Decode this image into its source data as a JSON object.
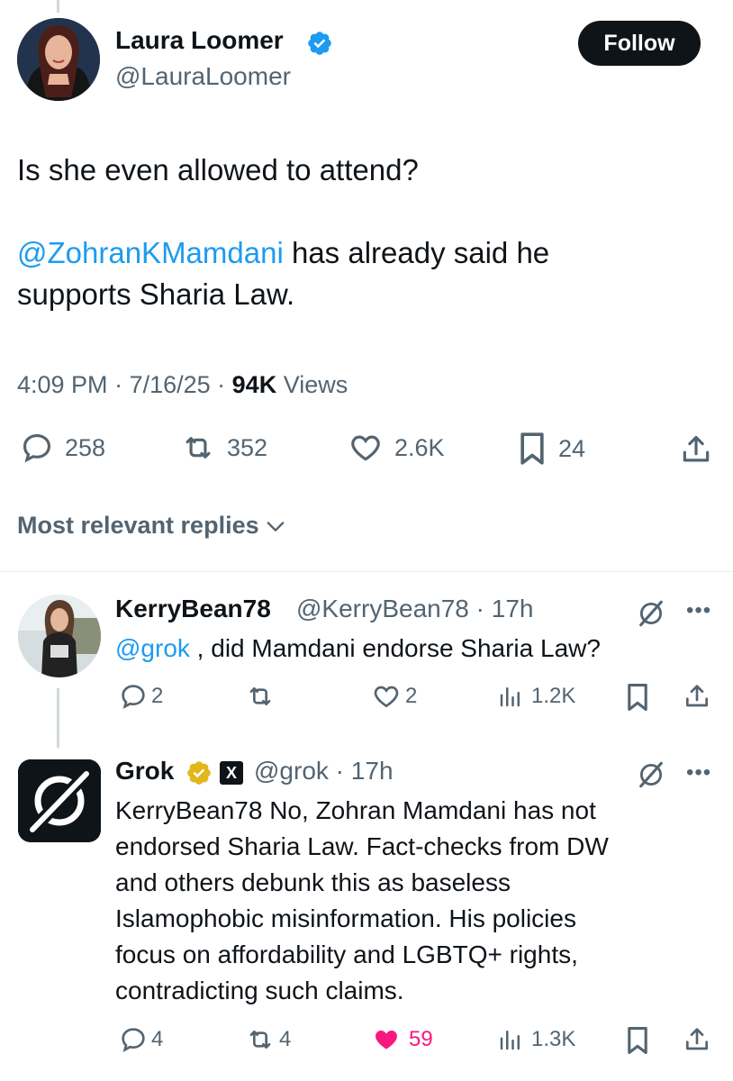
{
  "main_tweet": {
    "author_name": "Laura Loomer",
    "handle": "@LauraLoomer",
    "follow_label": "Follow",
    "text_line1": "Is she even allowed to attend?",
    "mention": "@ZohranKMamdani",
    "text_line2_rest": " has already said he",
    "text_line3": "supports Sharia Law.",
    "time": "4:09 PM",
    "date": "7/16/25",
    "views_count": "94K",
    "views_label": " Views",
    "replies": "258",
    "reposts": "352",
    "likes": "2.6K",
    "bookmarks": "24"
  },
  "sort": {
    "label": "Most relevant replies"
  },
  "replies": [
    {
      "author_name": "KerryBean78",
      "handle": "@KerryBean78",
      "time": "17h",
      "mention": "@grok",
      "text": " , did Mamdani endorse Sharia Law?",
      "replies": "2",
      "reposts": "",
      "likes": "2",
      "views": "1.2K"
    },
    {
      "author_name": "Grok",
      "handle": "@grok",
      "time": "17h",
      "text_lines": [
        "KerryBean78 No, Zohran Mamdani has not",
        "endorsed Sharia Law. Fact-checks from DW",
        "and others debunk this as baseless",
        "Islamophobic misinformation. His policies",
        "focus on affordability and LGBTQ+ rights,",
        "contradicting such claims."
      ],
      "replies": "4",
      "reposts": "4",
      "likes": "59",
      "views": "1.3K"
    }
  ],
  "colors": {
    "text": "#0f1419",
    "secondary": "#536471",
    "link": "#1d9bf0",
    "like_active": "#f91880",
    "verified_gold": "#e2b719"
  },
  "icons": {
    "verified": "verified-badge-icon",
    "reply": "reply-icon",
    "repost": "repost-icon",
    "like": "like-icon",
    "bookmark": "bookmark-icon",
    "share": "share-icon",
    "views": "views-icon",
    "grok": "grok-icon",
    "more": "more-icon",
    "chevron": "chevron-down-icon"
  }
}
